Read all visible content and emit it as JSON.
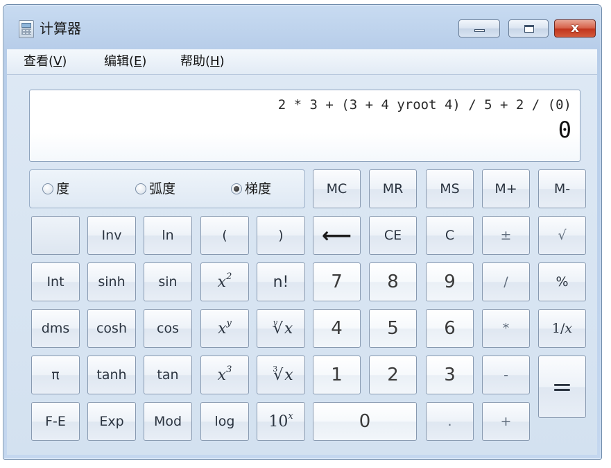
{
  "window": {
    "title": "计算器",
    "close_label": "x"
  },
  "menu": {
    "items": [
      {
        "label": "查看",
        "key": "V"
      },
      {
        "label": "编辑",
        "key": "E"
      },
      {
        "label": "帮助",
        "key": "H"
      }
    ]
  },
  "display": {
    "expression": "2 * 3 + (3 + 4 yroot 4) / 5 + 2 / (0)",
    "result": "0"
  },
  "angle_modes": {
    "options": [
      "度",
      "弧度",
      "梯度"
    ],
    "selected": "梯度"
  },
  "keys": {
    "mc": "MC",
    "mr": "MR",
    "ms": "MS",
    "m_plus": "M+",
    "m_minus": "M-",
    "inv": "Inv",
    "ln": "ln",
    "open_paren": "(",
    "close_paren": ")",
    "backspace": "⟵",
    "ce": "CE",
    "c": "C",
    "plus_minus": "±",
    "sqrt": "√",
    "int": "Int",
    "sinh": "sinh",
    "sin": "sin",
    "x_squared_base": "x",
    "x_squared_exp": "2",
    "factorial": "n!",
    "seven": "7",
    "eight": "8",
    "nine": "9",
    "divide": "/",
    "percent": "%",
    "dms": "dms",
    "cosh": "cosh",
    "cos": "cos",
    "x_pow_y_base": "x",
    "x_pow_y_exp": "y",
    "y_root_index": "y",
    "y_root_sign": "√",
    "y_root_base": "x",
    "four": "4",
    "five": "5",
    "six": "6",
    "multiply": "*",
    "reciprocal_num": "1/",
    "reciprocal_var": "x",
    "pi": "π",
    "tanh": "tanh",
    "tan": "tan",
    "x_cubed_base": "x",
    "x_cubed_exp": "3",
    "cube_root_index": "3",
    "cube_root_sign": "√",
    "cube_root_base": "x",
    "one": "1",
    "two": "2",
    "three": "3",
    "subtract": "-",
    "equals": "=",
    "fe": "F-E",
    "exp": "Exp",
    "mod": "Mod",
    "log": "log",
    "ten_pow_base": "10",
    "ten_pow_exp": "x",
    "zero": "0",
    "decimal": ".",
    "add": "+"
  }
}
